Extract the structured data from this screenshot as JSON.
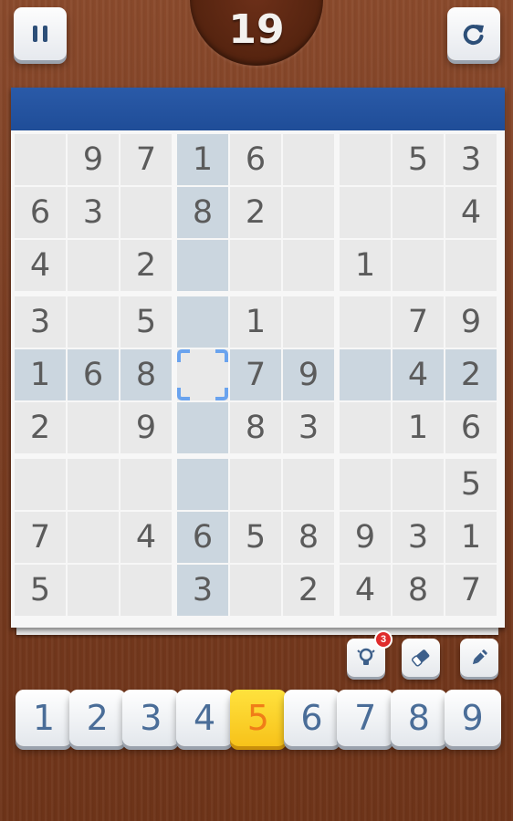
{
  "header": {
    "timer": "19",
    "pause_icon": "pause-icon",
    "restart_icon": "restart-icon"
  },
  "colors": {
    "header_bar": "#1f4d98",
    "highlight": "#cbd6df",
    "selection": "#6aa3ee",
    "active_key": "#f7c21a"
  },
  "board": {
    "selected": {
      "row": 4,
      "col": 3
    },
    "rows": [
      [
        "",
        "9",
        "7",
        "1",
        "6",
        "",
        "",
        "5",
        "3"
      ],
      [
        "6",
        "3",
        "",
        "8",
        "2",
        "",
        "",
        "",
        "4"
      ],
      [
        "4",
        "",
        "2",
        "",
        "",
        "",
        "1",
        "",
        ""
      ],
      [
        "3",
        "",
        "5",
        "",
        "1",
        "",
        "",
        "7",
        "9"
      ],
      [
        "1",
        "6",
        "8",
        "",
        "7",
        "9",
        "",
        "4",
        "2"
      ],
      [
        "2",
        "",
        "9",
        "",
        "8",
        "3",
        "",
        "1",
        "6"
      ],
      [
        "",
        "",
        "",
        "",
        "",
        "",
        "",
        "",
        "5"
      ],
      [
        "7",
        "",
        "4",
        "6",
        "5",
        "8",
        "9",
        "3",
        "1"
      ],
      [
        "5",
        "",
        "",
        "3",
        "",
        "2",
        "4",
        "8",
        "7"
      ]
    ]
  },
  "tools": {
    "hint_icon": "lightbulb-icon",
    "hint_count": "3",
    "erase_icon": "eraser-icon",
    "pencil_icon": "pencil-icon"
  },
  "numpad": {
    "keys": [
      "1",
      "2",
      "3",
      "4",
      "5",
      "6",
      "7",
      "8",
      "9"
    ],
    "active": "5"
  }
}
